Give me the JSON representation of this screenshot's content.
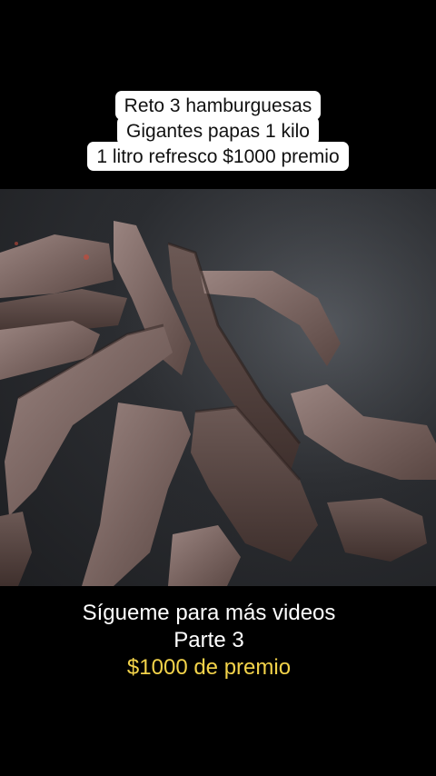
{
  "overlay_top": {
    "lines": [
      "Reto 3 hamburguesas",
      "Gigantes papas 1 kilo",
      "1 litro refresco $1000 premio"
    ]
  },
  "overlay_bottom": {
    "line1": "Sígueme para más videos",
    "line2": "Parte 3",
    "line3": "$1000 de premio"
  },
  "colors": {
    "background": "#000000",
    "caption_box": "#ffffff",
    "caption_text": "#111111",
    "bottom_text": "#ffffff",
    "prize_text": "#f3d34a",
    "meat": "#7b6763",
    "pan": "#2b2d31"
  }
}
